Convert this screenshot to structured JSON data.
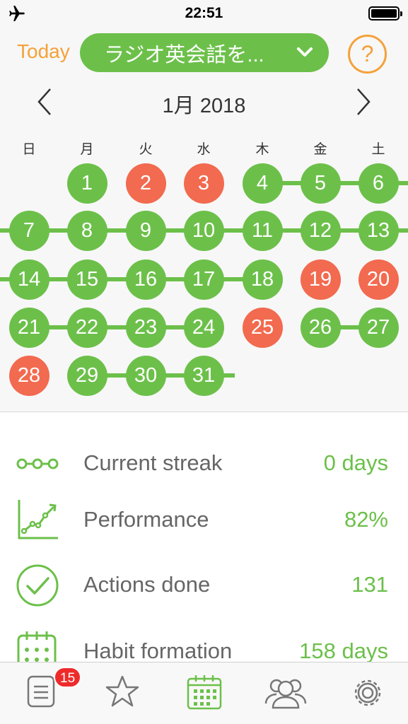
{
  "status_bar": {
    "time": "22:51"
  },
  "header": {
    "today_label": "Today",
    "habit_name": "ラジオ英会話を...",
    "help_label": "?"
  },
  "calendar": {
    "month_label": "1月 2018",
    "weekdays": [
      "日",
      "月",
      "火",
      "水",
      "木",
      "金",
      "土"
    ],
    "days": [
      {
        "n": "1",
        "s": "done"
      },
      {
        "n": "2",
        "s": "missed"
      },
      {
        "n": "3",
        "s": "missed"
      },
      {
        "n": "4",
        "s": "done"
      },
      {
        "n": "5",
        "s": "done"
      },
      {
        "n": "6",
        "s": "done"
      },
      {
        "n": "7",
        "s": "done"
      },
      {
        "n": "8",
        "s": "done"
      },
      {
        "n": "9",
        "s": "done"
      },
      {
        "n": "10",
        "s": "done"
      },
      {
        "n": "11",
        "s": "done"
      },
      {
        "n": "12",
        "s": "done"
      },
      {
        "n": "13",
        "s": "done"
      },
      {
        "n": "14",
        "s": "done"
      },
      {
        "n": "15",
        "s": "done"
      },
      {
        "n": "16",
        "s": "done"
      },
      {
        "n": "17",
        "s": "done"
      },
      {
        "n": "18",
        "s": "done"
      },
      {
        "n": "19",
        "s": "missed"
      },
      {
        "n": "20",
        "s": "missed"
      },
      {
        "n": "21",
        "s": "done"
      },
      {
        "n": "22",
        "s": "done"
      },
      {
        "n": "23",
        "s": "done"
      },
      {
        "n": "24",
        "s": "done"
      },
      {
        "n": "25",
        "s": "missed"
      },
      {
        "n": "26",
        "s": "done"
      },
      {
        "n": "27",
        "s": "done"
      },
      {
        "n": "28",
        "s": "missed"
      },
      {
        "n": "29",
        "s": "done"
      },
      {
        "n": "30",
        "s": "done"
      },
      {
        "n": "31",
        "s": "done"
      }
    ]
  },
  "stats": [
    {
      "icon": "streak-icon",
      "label": "Current streak",
      "value": "0 days"
    },
    {
      "icon": "performance-icon",
      "label": "Performance",
      "value": "82%"
    },
    {
      "icon": "check-circle-icon",
      "label": "Actions done",
      "value": "131"
    },
    {
      "icon": "calendar-grid-icon",
      "label": "Habit formation",
      "value": "158 days"
    }
  ],
  "tabbar": {
    "badge_count": "15",
    "tabs": [
      "list-icon",
      "star-icon",
      "calendar-icon",
      "people-icon",
      "gear-icon"
    ],
    "active_tab": "calendar-icon"
  },
  "colors": {
    "done": "#6cc04a",
    "missed": "#f26a4f",
    "accent": "#f5a13a"
  }
}
